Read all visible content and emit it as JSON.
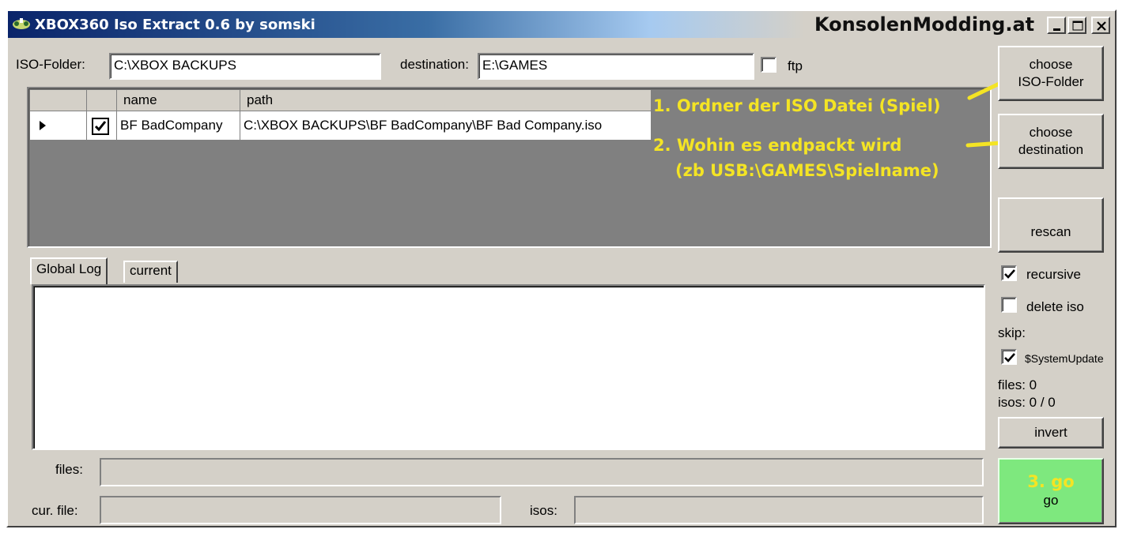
{
  "window": {
    "title": "XBOX360 Iso Extract 0.6 by somski",
    "brand": "KonsolenModding.at",
    "controls": {
      "minimize": "minimize-icon",
      "maximize": "maximize-icon",
      "close": "close-icon"
    }
  },
  "top": {
    "iso_folder_label": "ISO-Folder:",
    "iso_folder_value": "C:\\XBOX BACKUPS",
    "destination_label": "destination:",
    "destination_value": "E:\\GAMES",
    "ftp_label": "ftp",
    "ftp_checked": false
  },
  "grid": {
    "columns": [
      "",
      "",
      "name",
      "path"
    ],
    "rows": [
      {
        "selected_marker": "row-pointer-icon",
        "checked": true,
        "name": "BF BadCompany",
        "path": "C:\\XBOX BACKUPS\\BF BadCompany\\BF Bad Company.iso"
      }
    ]
  },
  "annotations": {
    "step1": "1. Ordner der ISO Datei (Spiel)",
    "step2_line1": "2. Wohin es endpackt wird",
    "step2_line2": "(zb USB:\\GAMES\\Spielname)",
    "step3": "3. go",
    "color": "#f4e424"
  },
  "right_panel": {
    "choose_iso_folder": "choose\nISO-Folder",
    "choose_destination": "choose\ndestination",
    "rescan": "rescan",
    "recursive_label": "recursive",
    "recursive_checked": true,
    "delete_iso_label": "delete iso",
    "delete_iso_checked": false,
    "skip_label": "skip:",
    "system_update_label": "$SystemUpdate",
    "system_update_checked": true,
    "files_count": "files: 0",
    "isos_count": "isos: 0 / 0",
    "invert": "invert",
    "go": "go",
    "go_color": "#7ee87e"
  },
  "tabs": [
    {
      "label": "Global Log",
      "active": true
    },
    {
      "label": "current",
      "active": false
    }
  ],
  "status": {
    "files_label": "files:",
    "cur_file_label": "cur. file:",
    "isos_label": "isos:"
  }
}
